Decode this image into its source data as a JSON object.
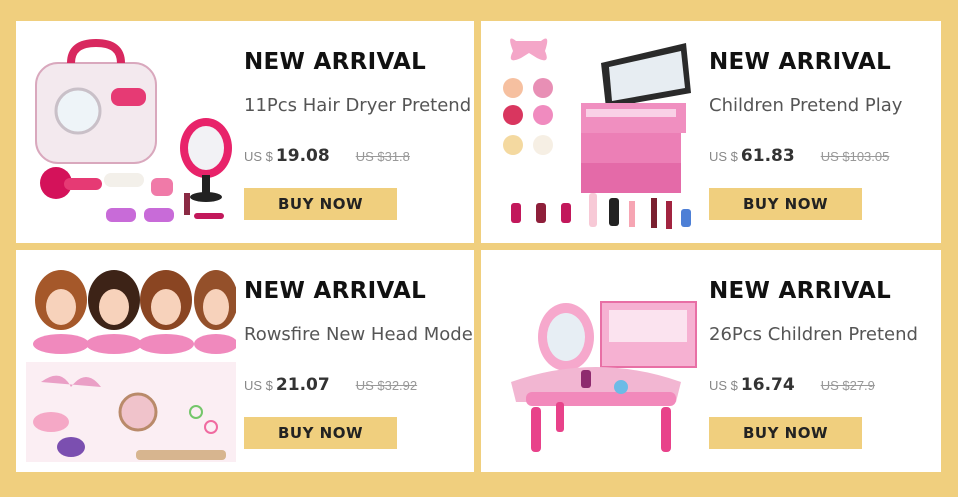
{
  "colors": {
    "background": "#f0cf7e",
    "card": "#ffffff",
    "button": "#f0cf7e",
    "accent_pink": "#e94a8c"
  },
  "products": [
    {
      "badge": "NEW ARRIVAL",
      "name": "11Pcs Hair Dryer Pretend",
      "currency": "US $",
      "price": "19.08",
      "old_price": "US $31.8",
      "button": "BUY NOW",
      "image_icon": "hair-dryer-playset-icon"
    },
    {
      "badge": "NEW ARRIVAL",
      "name": "Children Pretend Play",
      "currency": "US $",
      "price": "61.83",
      "old_price": "US $103.05",
      "button": "BUY NOW",
      "image_icon": "makeup-box-icon"
    },
    {
      "badge": "NEW ARRIVAL",
      "name": "Rowsfire New Head Model",
      "currency": "US $",
      "price": "21.07",
      "old_price": "US $32.92",
      "button": "BUY NOW",
      "image_icon": "doll-head-icon"
    },
    {
      "badge": "NEW ARRIVAL",
      "name": "26Pcs Children Pretend",
      "currency": "US $",
      "price": "16.74",
      "old_price": "US $27.9",
      "button": "BUY NOW",
      "image_icon": "vanity-table-icon"
    }
  ]
}
